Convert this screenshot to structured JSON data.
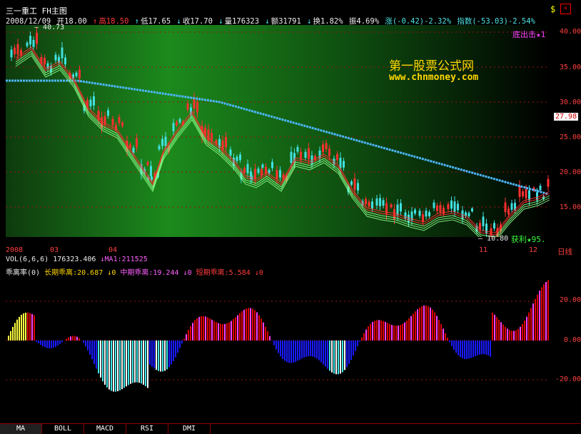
{
  "title_bar": {
    "stock": "三一重工",
    "view": "FH主图"
  },
  "quote": {
    "date": "2008/12/09",
    "open": "开18.00",
    "high": "高18.50",
    "low": "低17.65",
    "close": "收17.70",
    "volume": "量176323",
    "amount": "额31791",
    "turnover": "换1.82%",
    "amplitude": "振4.69%",
    "change": "涨(-0.42)-2.32%",
    "index": "指数(-53.03)-2.54%"
  },
  "watermark": {
    "line1": "第一股票公式网",
    "line2": "www.chnmoney.com"
  },
  "signals": {
    "top": "底出击★1",
    "bottom": "获利★95."
  },
  "main_axis": {
    "labels": [
      "40.00",
      "35.00",
      "30.00",
      "25.00",
      "20.00",
      "15.00"
    ],
    "highlight": "27.98"
  },
  "price_marks": {
    "high": "40.73",
    "low": "10.80"
  },
  "date_axis": {
    "labels": [
      "2008",
      "03",
      "04",
      "11",
      "12"
    ]
  },
  "period_label": "日线",
  "volume_line": {
    "label": "VOL(6,6,6)",
    "value": "176323.406",
    "ma": "MA1:211525"
  },
  "indicator": {
    "name": "乖离率(0)",
    "long_label": "长期乖离:20.687",
    "mid_label": "中期乖离:19.244",
    "short_label": "短期乖离:5.584",
    "arrow_zero": "0",
    "axis_labels": [
      "20.00",
      "0.00",
      "-20.00"
    ]
  },
  "tabs": [
    "MA",
    "BOLL",
    "MACD",
    "RSI",
    "DMI"
  ],
  "colors": {
    "up": "#ff3c3c",
    "down": "#4ce6e6",
    "ma_long": "#4db8ff",
    "ribbon": "#8aff8a"
  }
}
